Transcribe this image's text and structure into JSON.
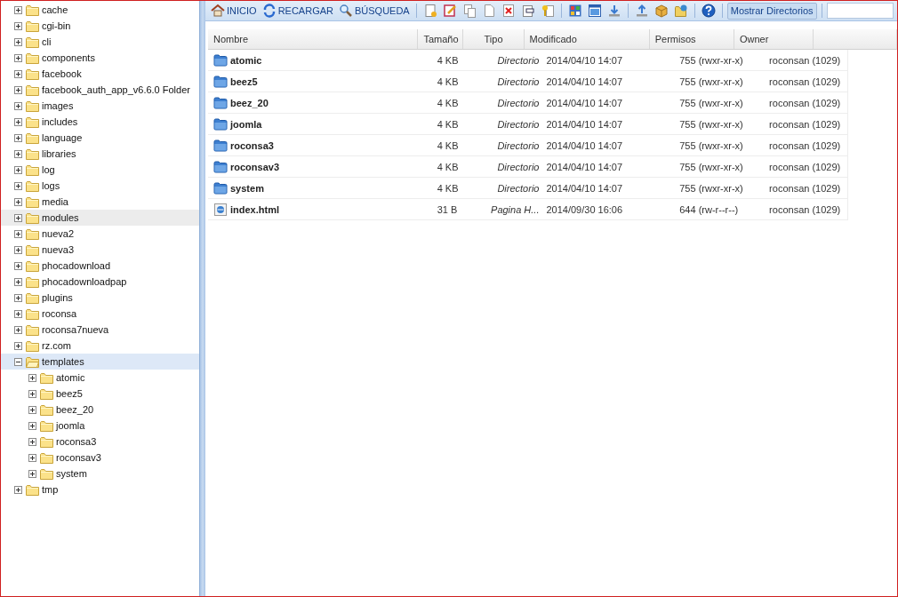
{
  "tree": [
    {
      "label": "cache",
      "expanded": false,
      "selected": false,
      "hovered": false
    },
    {
      "label": "cgi-bin",
      "expanded": false,
      "selected": false,
      "hovered": false
    },
    {
      "label": "cli",
      "expanded": false,
      "selected": false,
      "hovered": false
    },
    {
      "label": "components",
      "expanded": false,
      "selected": false,
      "hovered": false
    },
    {
      "label": "facebook",
      "expanded": false,
      "selected": false,
      "hovered": false
    },
    {
      "label": "facebook_auth_app_v6.6.0 Folder",
      "expanded": false,
      "selected": false,
      "hovered": false
    },
    {
      "label": "images",
      "expanded": false,
      "selected": false,
      "hovered": false
    },
    {
      "label": "includes",
      "expanded": false,
      "selected": false,
      "hovered": false
    },
    {
      "label": "language",
      "expanded": false,
      "selected": false,
      "hovered": false
    },
    {
      "label": "libraries",
      "expanded": false,
      "selected": false,
      "hovered": false
    },
    {
      "label": "log",
      "expanded": false,
      "selected": false,
      "hovered": false
    },
    {
      "label": "logs",
      "expanded": false,
      "selected": false,
      "hovered": false
    },
    {
      "label": "media",
      "expanded": false,
      "selected": false,
      "hovered": false
    },
    {
      "label": "modules",
      "expanded": false,
      "selected": false,
      "hovered": true
    },
    {
      "label": "nueva2",
      "expanded": false,
      "selected": false,
      "hovered": false
    },
    {
      "label": "nueva3",
      "expanded": false,
      "selected": false,
      "hovered": false
    },
    {
      "label": "phocadownload",
      "expanded": false,
      "selected": false,
      "hovered": false
    },
    {
      "label": "phocadownloadpap",
      "expanded": false,
      "selected": false,
      "hovered": false
    },
    {
      "label": "plugins",
      "expanded": false,
      "selected": false,
      "hovered": false
    },
    {
      "label": "roconsa",
      "expanded": false,
      "selected": false,
      "hovered": false
    },
    {
      "label": "roconsa7nueva",
      "expanded": false,
      "selected": false,
      "hovered": false
    },
    {
      "label": "rz.com",
      "expanded": false,
      "selected": false,
      "hovered": false
    },
    {
      "label": "templates",
      "expanded": true,
      "selected": true,
      "hovered": false,
      "children": [
        {
          "label": "atomic",
          "expanded": false,
          "selected": false,
          "hovered": false
        },
        {
          "label": "beez5",
          "expanded": false,
          "selected": false,
          "hovered": false
        },
        {
          "label": "beez_20",
          "expanded": false,
          "selected": false,
          "hovered": false
        },
        {
          "label": "joomla",
          "expanded": false,
          "selected": false,
          "hovered": false
        },
        {
          "label": "roconsa3",
          "expanded": false,
          "selected": false,
          "hovered": false
        },
        {
          "label": "roconsav3",
          "expanded": false,
          "selected": false,
          "hovered": false
        },
        {
          "label": "system",
          "expanded": false,
          "selected": false,
          "hovered": false
        }
      ]
    },
    {
      "label": "tmp",
      "expanded": false,
      "selected": false,
      "hovered": false
    }
  ],
  "toolbar": [
    {
      "kind": "text",
      "label": "INICIO"
    },
    {
      "kind": "text",
      "label": "RECARGAR"
    },
    {
      "kind": "text",
      "label": "BÚSQUEDA"
    },
    {
      "kind": "separator"
    },
    {
      "kind": "icon"
    },
    {
      "kind": "icon"
    },
    {
      "kind": "icon"
    },
    {
      "kind": "icon"
    },
    {
      "kind": "icon"
    },
    {
      "kind": "icon"
    },
    {
      "kind": "icon"
    },
    {
      "kind": "separator"
    },
    {
      "kind": "icon"
    },
    {
      "kind": "icon"
    },
    {
      "kind": "icon"
    },
    {
      "kind": "separator"
    },
    {
      "kind": "icon"
    },
    {
      "kind": "icon"
    },
    {
      "kind": "icon"
    },
    {
      "kind": "separator"
    },
    {
      "kind": "icon"
    },
    {
      "kind": "separator"
    },
    {
      "kind": "toggle",
      "label": "Mostrar Directorios",
      "selected": true
    },
    {
      "kind": "separator"
    },
    {
      "kind": "field"
    }
  ],
  "table": {
    "columns": [
      "Nombre",
      "Tamaño",
      "Tipo",
      "Modificado",
      "Permisos",
      "Owner"
    ],
    "rows": [
      {
        "kind": "folder",
        "name": "atomic",
        "size": "4 KB",
        "type": "Directorio",
        "modified": "2014/04/10 14:07",
        "permissions": "755 (rwxr-xr-x)",
        "owner": "roconsan (1029)"
      },
      {
        "kind": "folder",
        "name": "beez5",
        "size": "4 KB",
        "type": "Directorio",
        "modified": "2014/04/10 14:07",
        "permissions": "755 (rwxr-xr-x)",
        "owner": "roconsan (1029)"
      },
      {
        "kind": "folder",
        "name": "beez_20",
        "size": "4 KB",
        "type": "Directorio",
        "modified": "2014/04/10 14:07",
        "permissions": "755 (rwxr-xr-x)",
        "owner": "roconsan (1029)"
      },
      {
        "kind": "folder",
        "name": "joomla",
        "size": "4 KB",
        "type": "Directorio",
        "modified": "2014/04/10 14:07",
        "permissions": "755 (rwxr-xr-x)",
        "owner": "roconsan (1029)"
      },
      {
        "kind": "folder",
        "name": "roconsa3",
        "size": "4 KB",
        "type": "Directorio",
        "modified": "2014/04/10 14:07",
        "permissions": "755 (rwxr-xr-x)",
        "owner": "roconsan (1029)"
      },
      {
        "kind": "folder",
        "name": "roconsav3",
        "size": "4 KB",
        "type": "Directorio",
        "modified": "2014/04/10 14:07",
        "permissions": "755 (rwxr-xr-x)",
        "owner": "roconsan (1029)"
      },
      {
        "kind": "folder",
        "name": "system",
        "size": "4 KB",
        "type": "Directorio",
        "modified": "2014/04/10 14:07",
        "permissions": "755 (rwxr-xr-x)",
        "owner": "roconsan (1029)"
      },
      {
        "kind": "file",
        "name": "index.html",
        "size": "31 B",
        "type": "Pagina H...",
        "modified": "2014/09/30 16:06",
        "permissions": "644 (rw-r--r--)",
        "owner": "roconsan (1029)"
      }
    ]
  }
}
